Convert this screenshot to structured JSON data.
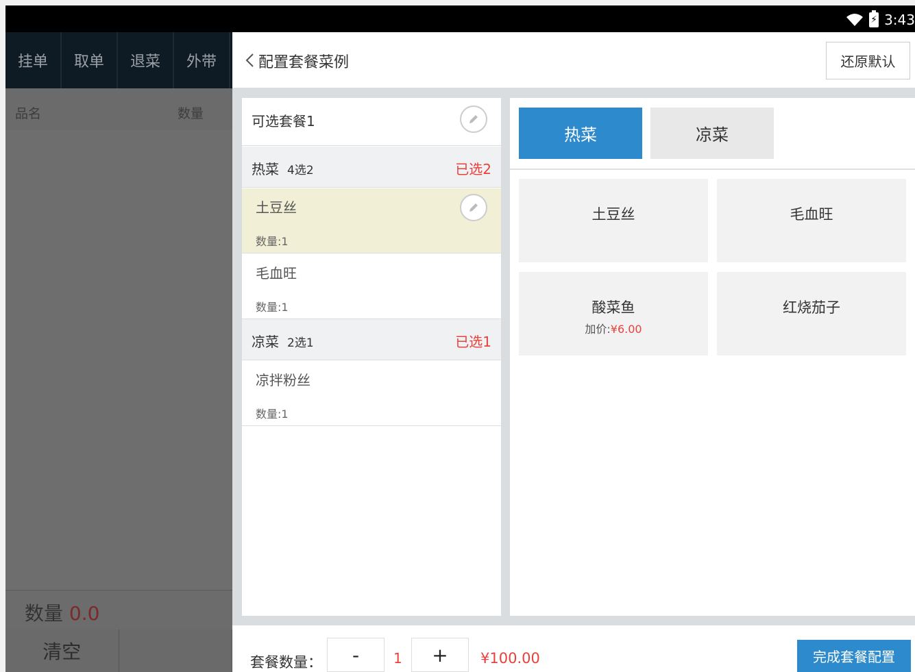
{
  "status_bar": {
    "time": "3:43"
  },
  "left_panel": {
    "tabs": [
      "挂单",
      "取单",
      "退菜",
      "外带"
    ],
    "header": {
      "col_name": "品名",
      "col_qty": "数量"
    },
    "qty_label": "数量",
    "qty_value": "0.0",
    "clear_label": "清空"
  },
  "config": {
    "title": "配置套餐菜例",
    "reset_label": "还原默认",
    "combo_name": "可选套餐1",
    "groups": [
      {
        "name": "热菜",
        "rule": "4选2",
        "selected": "已选2",
        "dishes": [
          {
            "name": "土豆丝",
            "qty": "数量:1"
          },
          {
            "name": "毛血旺",
            "qty": "数量:1"
          }
        ]
      },
      {
        "name": "凉菜",
        "rule": "2选1",
        "selected": "已选1",
        "dishes": [
          {
            "name": "凉拌粉丝",
            "qty": "数量:1"
          }
        ]
      }
    ],
    "categories": [
      "热菜",
      "凉菜"
    ],
    "dish_options": [
      {
        "name": "土豆丝"
      },
      {
        "name": "毛血旺"
      },
      {
        "name": "酸菜鱼",
        "extra_label": "加价:",
        "extra_price": "¥6.00"
      },
      {
        "name": "红烧茄子"
      }
    ],
    "footer": {
      "qty_label": "套餐数量：",
      "minus": "-",
      "qty": "1",
      "plus": "+",
      "price": "¥100.00",
      "finish_label": "完成套餐配置"
    }
  },
  "colors": {
    "accent": "#2d8acd",
    "warning": "#e8413c",
    "highlight_row": "#f1efd6"
  }
}
